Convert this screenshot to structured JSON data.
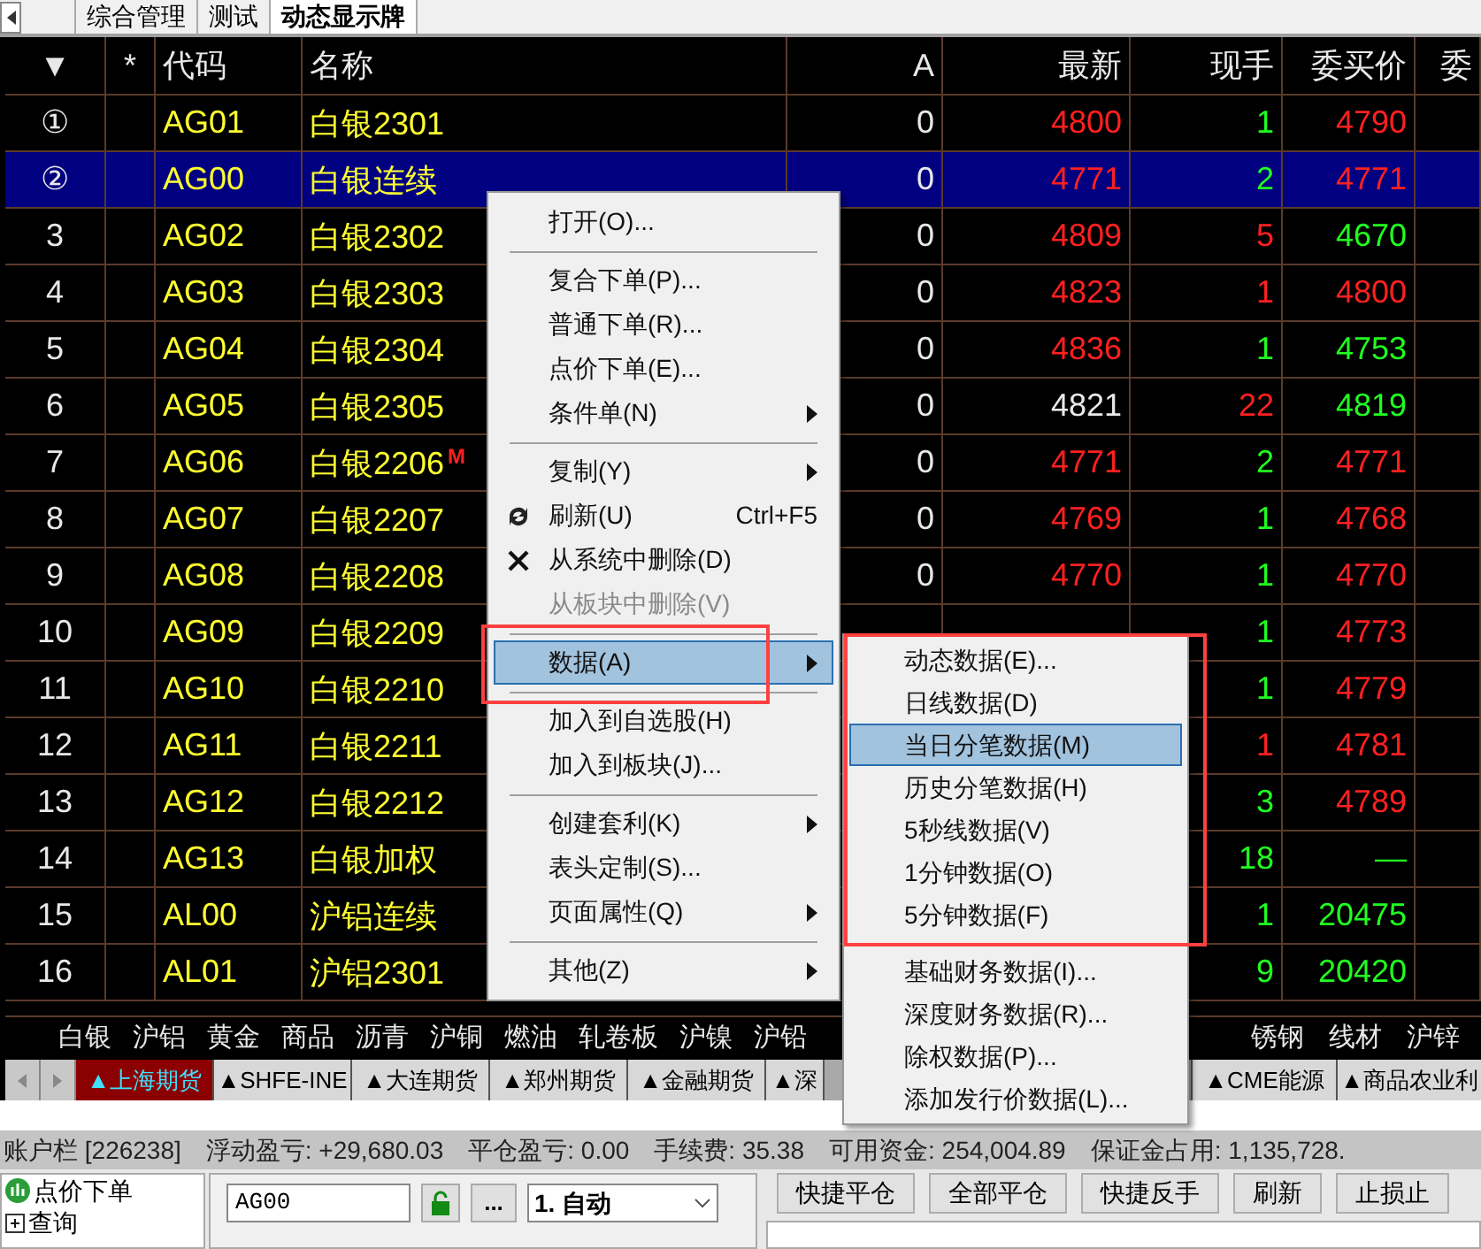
{
  "tabs": [
    {
      "label": "综合管理",
      "selected": false
    },
    {
      "label": "测试",
      "selected": false
    },
    {
      "label": "动态显示牌",
      "selected": true
    }
  ],
  "table": {
    "columns": [
      "▼",
      "*",
      "代码",
      "名称",
      "A",
      "最新",
      "现手",
      "委买价",
      "委"
    ],
    "rows": [
      {
        "num": "①",
        "code": "AG01",
        "name": "白银2301",
        "a": "0",
        "last": {
          "text": "4800",
          "color": "#ff2020"
        },
        "vol": {
          "text": "1",
          "color": "#20ff20"
        },
        "bid": {
          "text": "4790",
          "color": "#ff2020"
        },
        "selected": false
      },
      {
        "num": "②",
        "code": "AG00",
        "name": "白银连续",
        "a": "0",
        "last": {
          "text": "4771",
          "color": "#ff2020"
        },
        "vol": {
          "text": "2",
          "color": "#20ff20"
        },
        "bid": {
          "text": "4771",
          "color": "#ff2020"
        },
        "selected": true
      },
      {
        "num": "3",
        "code": "AG02",
        "name": "白银2302",
        "a": "0",
        "last": {
          "text": "4809",
          "color": "#ff2020"
        },
        "vol": {
          "text": "5",
          "color": "#ff2020"
        },
        "bid": {
          "text": "4670",
          "color": "#20ff20"
        },
        "selected": false
      },
      {
        "num": "4",
        "code": "AG03",
        "name": "白银2303",
        "a": "0",
        "last": {
          "text": "4823",
          "color": "#ff2020"
        },
        "vol": {
          "text": "1",
          "color": "#ff2020"
        },
        "bid": {
          "text": "4800",
          "color": "#ff2020"
        },
        "selected": false
      },
      {
        "num": "5",
        "code": "AG04",
        "name": "白银2304",
        "a": "0",
        "last": {
          "text": "4836",
          "color": "#ff2020"
        },
        "vol": {
          "text": "1",
          "color": "#20ff20"
        },
        "bid": {
          "text": "4753",
          "color": "#20ff20"
        },
        "selected": false
      },
      {
        "num": "6",
        "code": "AG05",
        "name": "白银2305",
        "a": "0",
        "last": {
          "text": "4821",
          "color": "#e8e8e8"
        },
        "vol": {
          "text": "22",
          "color": "#ff2020"
        },
        "bid": {
          "text": "4819",
          "color": "#20ff20"
        },
        "selected": false
      },
      {
        "num": "7",
        "code": "AG06",
        "name": "白银2206",
        "flag": "M",
        "a": "0",
        "last": {
          "text": "4771",
          "color": "#ff2020"
        },
        "vol": {
          "text": "2",
          "color": "#20ff20"
        },
        "bid": {
          "text": "4771",
          "color": "#ff2020"
        },
        "selected": false
      },
      {
        "num": "8",
        "code": "AG07",
        "name": "白银2207",
        "a": "0",
        "last": {
          "text": "4769",
          "color": "#ff2020"
        },
        "vol": {
          "text": "1",
          "color": "#20ff20"
        },
        "bid": {
          "text": "4768",
          "color": "#ff2020"
        },
        "selected": false
      },
      {
        "num": "9",
        "code": "AG08",
        "name": "白银2208",
        "a": "0",
        "last": {
          "text": "4770",
          "color": "#ff2020"
        },
        "vol": {
          "text": "1",
          "color": "#20ff20"
        },
        "bid": {
          "text": "4770",
          "color": "#ff2020"
        },
        "selected": false
      },
      {
        "num": "10",
        "code": "AG09",
        "name": "白银2209",
        "vol": {
          "text": "1",
          "color": "#20ff20"
        },
        "bid": {
          "text": "4773",
          "color": "#ff2020"
        },
        "selected": false
      },
      {
        "num": "11",
        "code": "AG10",
        "name": "白银2210",
        "vol": {
          "text": "1",
          "color": "#20ff20"
        },
        "bid": {
          "text": "4779",
          "color": "#ff2020"
        },
        "selected": false
      },
      {
        "num": "12",
        "code": "AG11",
        "name": "白银2211",
        "vol": {
          "text": "1",
          "color": "#ff2020"
        },
        "bid": {
          "text": "4781",
          "color": "#ff2020"
        },
        "selected": false
      },
      {
        "num": "13",
        "code": "AG12",
        "name": "白银2212",
        "vol": {
          "text": "3",
          "color": "#20ff20"
        },
        "bid": {
          "text": "4789",
          "color": "#ff2020"
        },
        "selected": false
      },
      {
        "num": "14",
        "code": "AG13",
        "name": "白银加权",
        "vol": {
          "text": "18",
          "color": "#20ff20"
        },
        "bid": {
          "text": "—",
          "color": "#20ff20"
        },
        "selected": false
      },
      {
        "num": "15",
        "code": "AL00",
        "name": "沪铝连续",
        "vol": {
          "text": "1",
          "color": "#20ff20"
        },
        "bid": {
          "text": "20475",
          "color": "#20ff20"
        },
        "selected": false
      },
      {
        "num": "16",
        "code": "AL01",
        "name": "沪铝2301",
        "vol": {
          "text": "9",
          "color": "#20ff20"
        },
        "bid": {
          "text": "20420",
          "color": "#20ff20"
        },
        "selected": false
      }
    ]
  },
  "categories_left": [
    "白银",
    "沪铝",
    "黄金",
    "商品",
    "沥青",
    "沪铜",
    "燃油",
    "轧卷板",
    "沪镍",
    "沪铅"
  ],
  "categories_right": [
    "锈钢",
    "线材",
    "沪锌"
  ],
  "market_tabs_left": [
    {
      "label": "▲上海期货",
      "selected": true
    },
    {
      "label": "▲SHFE-INE",
      "selected": false
    },
    {
      "label": "▲大连期货",
      "selected": false
    },
    {
      "label": "▲郑州期货",
      "selected": false
    },
    {
      "label": "▲金融期货",
      "selected": false
    },
    {
      "label": "▲深",
      "selected": false
    }
  ],
  "market_tabs_right": [
    {
      "label": "▲CME能源",
      "selected": false
    },
    {
      "label": "▲商品农业利",
      "selected": false
    }
  ],
  "context_menu": [
    {
      "kind": "item",
      "label": "打开(O)...",
      "submenu": false,
      "disabled": false,
      "selected": false
    },
    {
      "kind": "separator"
    },
    {
      "kind": "item",
      "label": "复合下单(P)...",
      "submenu": false,
      "disabled": false,
      "selected": false
    },
    {
      "kind": "item",
      "label": "普通下单(R)...",
      "submenu": false,
      "disabled": false,
      "selected": false
    },
    {
      "kind": "item",
      "label": "点价下单(E)...",
      "submenu": false,
      "disabled": false,
      "selected": false
    },
    {
      "kind": "item",
      "label": "条件单(N)",
      "submenu": true,
      "disabled": false,
      "selected": false
    },
    {
      "kind": "separator"
    },
    {
      "kind": "item",
      "label": "复制(Y)",
      "submenu": true,
      "disabled": false,
      "selected": false
    },
    {
      "kind": "refresh",
      "label": "刷新(U)",
      "shortcut": "Ctrl+F5",
      "submenu": false,
      "disabled": false,
      "selected": false
    },
    {
      "kind": "delete",
      "label": "从系统中删除(D)",
      "submenu": false,
      "disabled": false,
      "selected": false
    },
    {
      "kind": "item",
      "label": "从板块中删除(V)",
      "submenu": false,
      "disabled": true,
      "selected": false
    },
    {
      "kind": "separator"
    },
    {
      "kind": "item",
      "label": "数据(A)",
      "submenu": true,
      "disabled": false,
      "selected": true
    },
    {
      "kind": "separator"
    },
    {
      "kind": "item",
      "label": "加入到自选股(H)",
      "submenu": false,
      "disabled": false,
      "selected": false
    },
    {
      "kind": "item",
      "label": "加入到板块(J)...",
      "submenu": false,
      "disabled": false,
      "selected": false
    },
    {
      "kind": "separator"
    },
    {
      "kind": "item",
      "label": "创建套利(K)",
      "submenu": true,
      "disabled": false,
      "selected": false
    },
    {
      "kind": "item",
      "label": "表头定制(S)...",
      "submenu": false,
      "disabled": false,
      "selected": false
    },
    {
      "kind": "item",
      "label": "页面属性(Q)",
      "submenu": true,
      "disabled": false,
      "selected": false
    },
    {
      "kind": "separator"
    },
    {
      "kind": "item",
      "label": "其他(Z)",
      "submenu": true,
      "disabled": false,
      "selected": false
    }
  ],
  "submenu": [
    {
      "kind": "item",
      "label": "动态数据(E)...",
      "selected": false
    },
    {
      "kind": "item",
      "label": "日线数据(D)",
      "selected": false
    },
    {
      "kind": "item",
      "label": "当日分笔数据(M)",
      "selected": true
    },
    {
      "kind": "item",
      "label": "历史分笔数据(H)",
      "selected": false
    },
    {
      "kind": "item",
      "label": "5秒线数据(V)",
      "selected": false
    },
    {
      "kind": "item",
      "label": "1分钟数据(O)",
      "selected": false
    },
    {
      "kind": "item",
      "label": "5分钟数据(F)",
      "selected": false
    },
    {
      "kind": "separator"
    },
    {
      "kind": "item",
      "label": "基础财务数据(I)...",
      "selected": false
    },
    {
      "kind": "item",
      "label": "深度财务数据(R)...",
      "selected": false
    },
    {
      "kind": "item",
      "label": "除权数据(P)...",
      "selected": false
    },
    {
      "kind": "item",
      "label": "添加发行价数据(L)...",
      "selected": false
    }
  ],
  "status_bar": [
    "账户栏 [226238]",
    "浮动盈亏: +29,680.03",
    "平仓盈亏: 0.00",
    "手续费: 35.38",
    "可用资金: 254,004.89",
    "保证金占用: 1,135,728."
  ],
  "tree": [
    {
      "kind": "leaf",
      "label": "点价下单"
    },
    {
      "kind": "group",
      "label": "查询",
      "expanded": false
    }
  ],
  "order": {
    "code": "AG00",
    "more": "...",
    "mode": "1. 自动"
  },
  "buttons": [
    "快捷平仓",
    "全部平仓",
    "快捷反手",
    "刷新",
    "止损止"
  ]
}
